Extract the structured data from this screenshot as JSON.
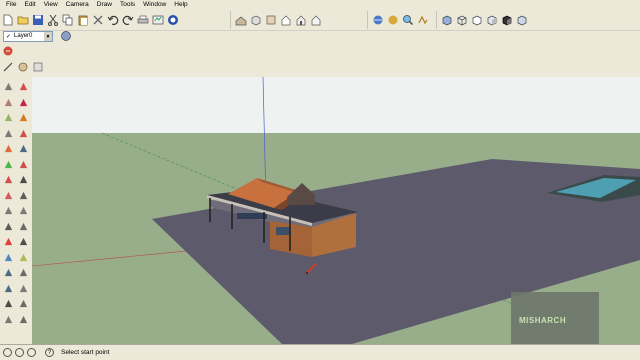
{
  "menu": [
    "File",
    "Edit",
    "View",
    "Camera",
    "Draw",
    "Tools",
    "Window",
    "Help"
  ],
  "layer": {
    "current": "Layer0",
    "check": "✓"
  },
  "status": {
    "prompt": "Select start point"
  },
  "watermark": "MISHARCH",
  "icons": {
    "top_row": [
      "new-file-icon",
      "open-folder-icon",
      "save-icon",
      "cut-icon",
      "copy-icon",
      "paste-icon",
      "erase-icon",
      "undo-icon",
      "redo-icon",
      "print-icon",
      "model-info-icon",
      "get-models-icon",
      "section-house-icon",
      "iso-view-icon",
      "top-view-icon",
      "front-view-icon",
      "right-view-icon",
      "back-view-icon",
      "left-view-icon",
      "orbit-icon",
      "pan-icon",
      "zoom-icon",
      "zoom-extents-icon",
      "xray-icon",
      "wireframe-icon",
      "hidden-line-icon",
      "shaded-icon",
      "shaded-texture-icon",
      "monochrome-icon"
    ],
    "left": [
      "select-icon",
      "make-component-icon",
      "paint-bucket-icon",
      "eraser-icon",
      "rectangle-icon",
      "line-icon",
      "circle-icon",
      "arc-icon",
      "polygon-icon",
      "freehand-icon",
      "move-icon",
      "push-pull-icon",
      "rotate-icon",
      "follow-me-icon",
      "scale-icon",
      "offset-icon",
      "tape-measure-icon",
      "dimension-icon",
      "protractor-icon",
      "text-icon",
      "axes-icon",
      "3d-text-icon",
      "orbit-icon",
      "pan-icon",
      "zoom-icon",
      "zoom-window-icon",
      "zoom-extents-icon",
      "previous-view-icon",
      "position-camera-icon",
      "look-around-icon",
      "walk-icon",
      "section-plane-icon"
    ]
  },
  "colors": {
    "sky": "#e9f1f0",
    "ground": "#97ae89",
    "slab": "#5c5a6b",
    "pool": "#4d9fb0",
    "roof": "#c06a3e"
  }
}
